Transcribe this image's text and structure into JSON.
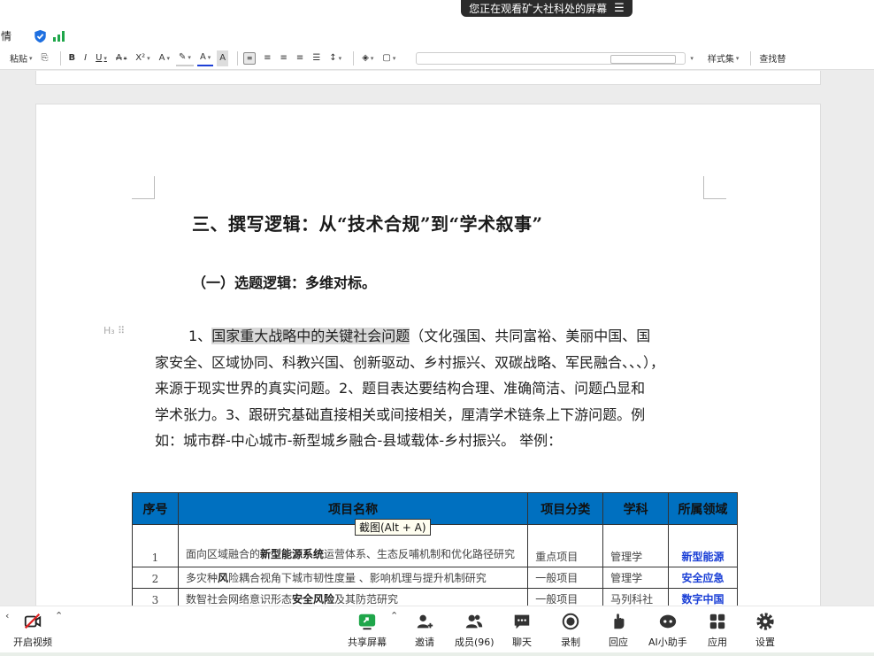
{
  "share_banner": {
    "text": "您正在观看矿大社科处的屏幕",
    "menu_icon": "menu-lines-icon"
  },
  "statusbar": {
    "doc_title": "情",
    "icons": [
      "shield-check-icon",
      "signal-bars-icon"
    ]
  },
  "ribbon": {
    "paste_label": "粘贴",
    "bold": "B",
    "italic": "I",
    "underline": "U",
    "strike": "A",
    "superscript": "X²",
    "styles_label": "样式集",
    "find_label": "查找替"
  },
  "document": {
    "heading": "三、撰写逻辑：从“技术合规”到“学术叙事”",
    "subheading": "（一）选题逻辑：多维对标。",
    "para_handle": "H₃ ⠿",
    "body_lines": [
      {
        "pre": "1、",
        "highlight": "国家重大战略中的关键社会问题",
        "post": "（文化强国、共同富裕、美丽中国、国"
      },
      {
        "pre": "家安全、区域协同、科教兴国、创新驱动、乡村振兴、双碳战略、军民融合、、、），",
        "highlight": "",
        "post": ""
      },
      {
        "pre": "来源于现实世界的真实问题。2、题目表达要结构合理、准确简洁、问题凸显和",
        "highlight": "",
        "post": ""
      },
      {
        "pre": "学术张力。3、跟研究基础直接相关或间接相关，厘清学术链条上下游问题。例",
        "highlight": "",
        "post": ""
      },
      {
        "pre": "如：城市群-中心城市-新型城乡融合-县域载体-乡村振兴。 举例：",
        "highlight": "",
        "post": ""
      }
    ],
    "table": {
      "headers": [
        "序号",
        "项目名称",
        "项目分类",
        "学科",
        "所属领域"
      ],
      "rows": [
        {
          "no": "1",
          "name_a": "面向区域融合的",
          "name_b": "新型能源系统",
          "name_c": "运营体系、生态反哺机制和优化路径研究",
          "category": "重点项目",
          "subject": "管理学",
          "domain": "新型能源"
        },
        {
          "no": "2",
          "name_a": "多灾种",
          "name_b": "风",
          "name_c": "险耦合视角下城市韧性度量 、影响机理与提升机制研究",
          "category": "一般项目",
          "subject": "管理学",
          "domain": "安全应急"
        },
        {
          "no": "3",
          "name_a": "数智社会网络意识形态",
          "name_b": "安全风险",
          "name_c": "及其防范研究",
          "category": "一般项目",
          "subject": "马列科社",
          "domain": "数字中国"
        }
      ]
    },
    "tooltip": "截图(Alt + A)"
  },
  "meeting_bar": {
    "video_label": "开启视频",
    "buttons": [
      {
        "label": "共享屏幕",
        "icon": "share-screen-icon"
      },
      {
        "label": "邀请",
        "icon": "invite-icon"
      },
      {
        "label": "成员(96)",
        "icon": "members-icon"
      },
      {
        "label": "聊天",
        "icon": "chat-icon"
      },
      {
        "label": "录制",
        "icon": "record-icon"
      },
      {
        "label": "回应",
        "icon": "reaction-icon"
      },
      {
        "label": "AI小助手",
        "icon": "ai-assistant-icon"
      },
      {
        "label": "应用",
        "icon": "apps-icon"
      },
      {
        "label": "设置",
        "icon": "settings-icon"
      }
    ]
  },
  "colors": {
    "table_header": "#0070c0",
    "domain_text": "#1a3fd6",
    "highlight": "#d9d9d9",
    "share_green": "#1fa64a"
  }
}
